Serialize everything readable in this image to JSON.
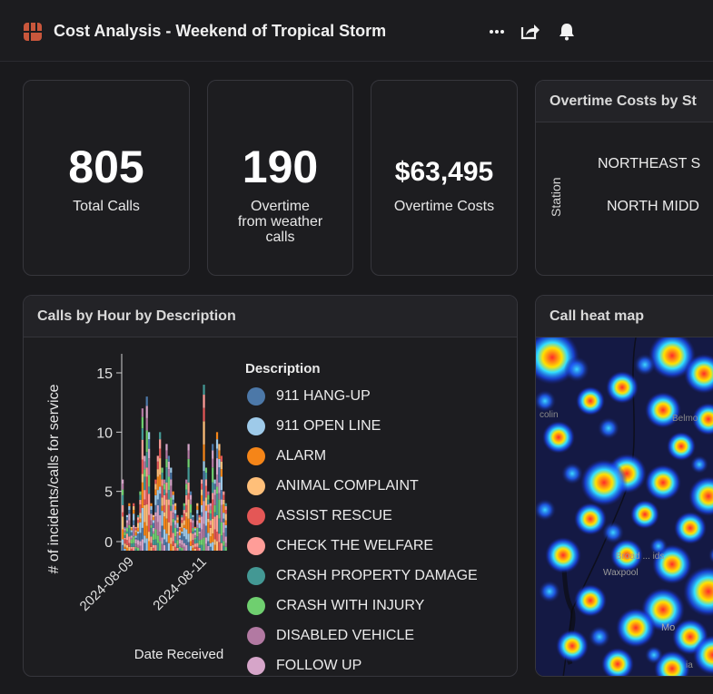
{
  "header": {
    "title": "Cost Analysis - Weekend of Tropical Storm",
    "icons": [
      "more-icon",
      "share-icon",
      "bell-icon"
    ]
  },
  "kpis": {
    "total_calls": {
      "value": "805",
      "label": "Total Calls"
    },
    "overtime": {
      "value": "190",
      "label_lines": [
        "Overtime",
        "from weather",
        "calls"
      ]
    },
    "overtime_costs": {
      "value": "$63,495",
      "label": "Overtime Costs"
    }
  },
  "overtime_panel": {
    "title": "Overtime Costs by St",
    "axis_label": "Station",
    "stations": [
      "NORTHEAST S",
      "NORTH MIDD"
    ]
  },
  "calls_panel": {
    "title": "Calls by Hour by Description",
    "legend_title": "Description",
    "legend": [
      {
        "label": "911 HANG-UP",
        "color": "#4c78a8"
      },
      {
        "label": "911 OPEN LINE",
        "color": "#9ecae9"
      },
      {
        "label": "ALARM",
        "color": "#f58518"
      },
      {
        "label": "ANIMAL COMPLAINT",
        "color": "#ffbf79"
      },
      {
        "label": "ASSIST RESCUE",
        "color": "#e45756"
      },
      {
        "label": "CHECK THE WELFARE",
        "color": "#ff9d98"
      },
      {
        "label": "CRASH PROPERTY DAMAGE",
        "color": "#439894"
      },
      {
        "label": "CRASH WITH INJURY",
        "color": "#6fcf6f"
      },
      {
        "label": "DISABLED VEHICLE",
        "color": "#b279a2"
      },
      {
        "label": "FOLLOW UP",
        "color": "#d6a5c9"
      }
    ]
  },
  "heatmap_panel": {
    "title": "Call heat map",
    "place_labels": [
      "colin",
      "Belmo",
      "Broad ... ids",
      "Waxpool",
      "Mo",
      "ia"
    ]
  },
  "chart_data": {
    "type": "bar",
    "stacked": true,
    "xlabel": "Date Received",
    "ylabel": "# of incidents/calls for service",
    "ylim": [
      0,
      17
    ],
    "yticks": [
      0,
      5,
      10,
      15
    ],
    "xticks": [
      "2024-08-09",
      "2024-08-11"
    ],
    "bar_count": 48,
    "totals": [
      6,
      2,
      3,
      4,
      2,
      4,
      2,
      3,
      5,
      12,
      8,
      13,
      10,
      4,
      3,
      6,
      8,
      10,
      7,
      6,
      9,
      8,
      7,
      5,
      4,
      3,
      2,
      3,
      4,
      6,
      9,
      5,
      3,
      2,
      4,
      3,
      6,
      14,
      7,
      5,
      4,
      9,
      6,
      10,
      9,
      8,
      5,
      4
    ]
  }
}
